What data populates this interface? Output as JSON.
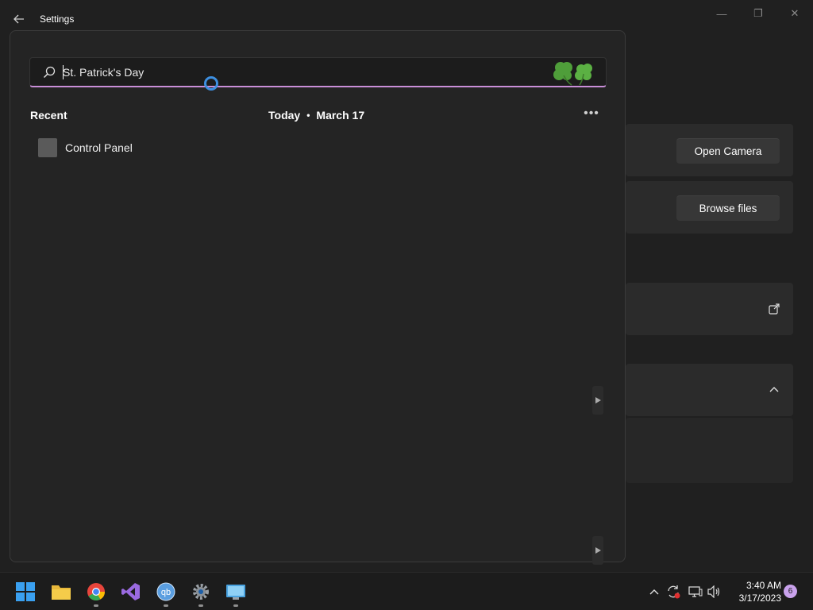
{
  "window": {
    "title": "Settings",
    "controls": {
      "minimize": "—",
      "maximize": "❐",
      "close": "✕"
    }
  },
  "background_panel": {
    "open_camera_label": "Open Camera",
    "browse_files_label": "Browse files"
  },
  "search": {
    "query": "St. Patrick's Day",
    "accent_color": "#c98ed8"
  },
  "flyout": {
    "recent_label": "Recent",
    "today_label": "Today",
    "separator": "•",
    "date_label": "March 17",
    "more_label": "•••",
    "recent_items": [
      {
        "label": "Control Panel"
      }
    ]
  },
  "taskbar": {
    "apps": [
      "start-icon",
      "file-explorer-icon",
      "chrome-icon",
      "visual-studio-icon",
      "qbittorrent-icon",
      "settings-icon",
      "remote-desktop-icon"
    ],
    "time": "3:40 AM",
    "date": "3/17/2023",
    "notification_count": "6"
  }
}
